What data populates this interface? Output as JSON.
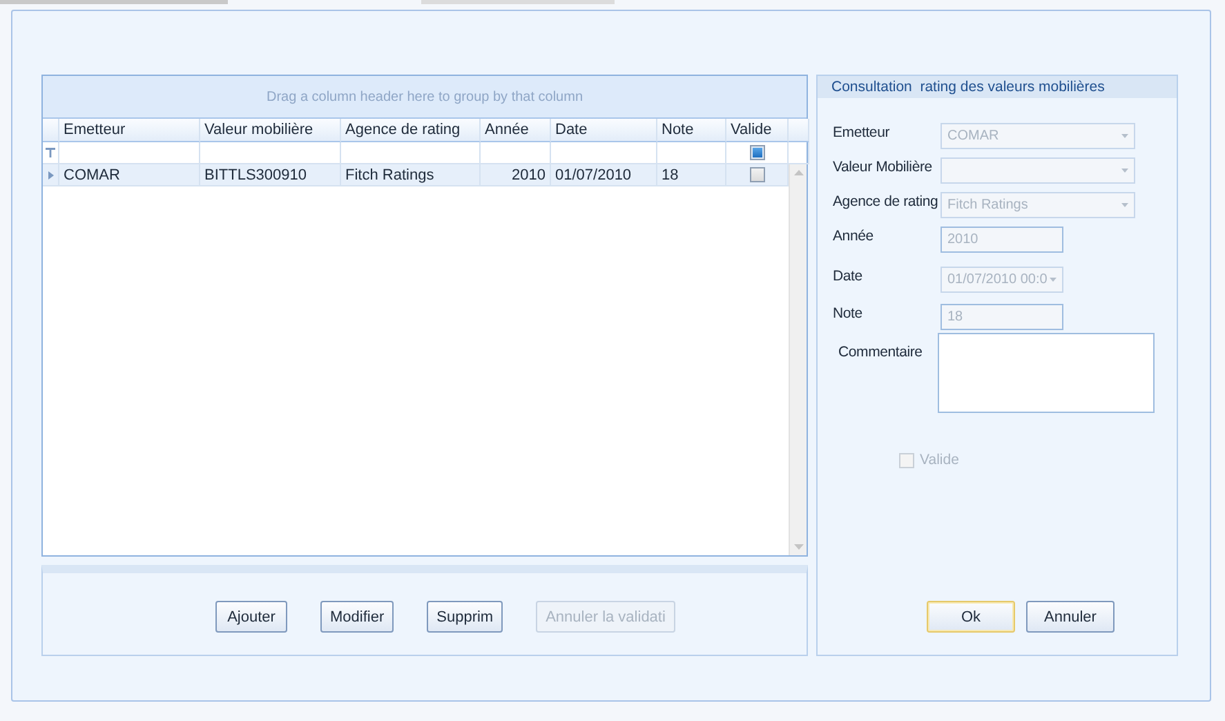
{
  "grid": {
    "group_hint": "Drag a column header here to group by that column",
    "columns": [
      "Emetteur",
      "Valeur mobilière",
      "Agence de rating",
      "Année",
      "Date",
      "Note",
      "Valide"
    ],
    "filter_row": {
      "valide_indeterminate": true
    },
    "rows": [
      {
        "selected": true,
        "cells": [
          "COMAR",
          "BITTLS300910",
          "Fitch Ratings",
          "2010",
          "01/07/2010",
          "18"
        ],
        "valide": false
      }
    ]
  },
  "grid_buttons": [
    {
      "label": "Ajouter",
      "disabled": false
    },
    {
      "label": "Modifier",
      "disabled": false
    },
    {
      "label": "Supprim",
      "disabled": false
    },
    {
      "label": "Annuler la validati",
      "disabled": true
    }
  ],
  "form": {
    "title": "Consultation  rating des valeurs mobilières",
    "fields": [
      {
        "kind": "combo",
        "label": "Emetteur",
        "value": "COMAR",
        "disabled": true
      },
      {
        "kind": "combo",
        "label": "Valeur Mobilière",
        "disabled": true
      },
      {
        "kind": "combo",
        "label": "Agence de rating",
        "value": "Fitch Ratings",
        "disabled": true
      },
      {
        "kind": "text",
        "label": "Année",
        "value": "2010",
        "disabled": true
      },
      {
        "kind": "date",
        "label": "Date",
        "value": "01/07/2010 00:0",
        "disabled": true
      },
      {
        "kind": "text",
        "label": "Note",
        "value": "18",
        "disabled": true
      },
      {
        "kind": "textarea",
        "label": "Commentaire"
      },
      {
        "kind": "checkbox",
        "label": "Valide",
        "checked": false,
        "disabled": true
      }
    ],
    "buttons": [
      {
        "label": "Ok",
        "default": true
      },
      {
        "label": "Annuler",
        "default": false
      }
    ]
  }
}
